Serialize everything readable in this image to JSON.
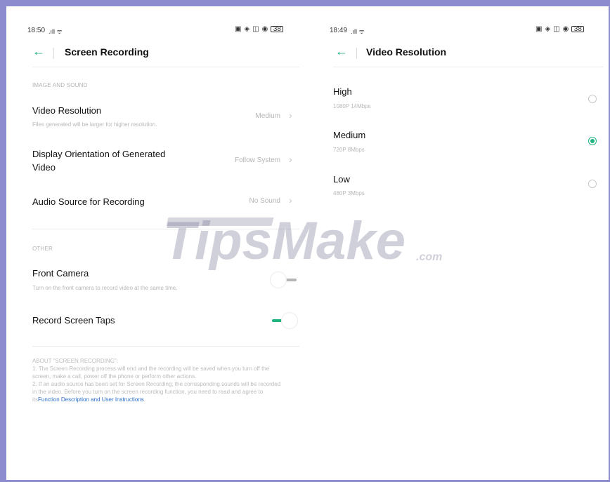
{
  "colors": {
    "accent": "#1fb37e",
    "frame": "#8d8ccf",
    "link": "#2b6fc8"
  },
  "left": {
    "status": {
      "time": "18:50",
      "battery": "38"
    },
    "header": {
      "back_icon": "arrow-left",
      "title": "Screen Recording"
    },
    "sections": {
      "image_sound": "IMAGE AND SOUND",
      "other": "OTHER"
    },
    "video_resolution": {
      "title": "Video Resolution",
      "subtitle": "Files generated will be larger for higher resolution.",
      "value": "Medium"
    },
    "display_orientation": {
      "title_line1": "Display Orientation of Generated",
      "title_line2": "Video",
      "value": "Follow System"
    },
    "audio_source": {
      "title": "Audio Source for Recording",
      "value": "No Sound"
    },
    "front_camera": {
      "title": "Front Camera",
      "subtitle": "Turn on the front camera to record video at the same time.",
      "enabled": false
    },
    "record_taps": {
      "title": "Record Screen Taps",
      "enabled": true
    },
    "about": {
      "heading": "ABOUT \"SCREEN RECORDING\":",
      "p1": "1. The Screen Recording process will end and the recording will be saved when you turn off the screen, make a call, power off the phone or perform other actions.",
      "p2_prefix": "2. If an audio source has been set for Screen Recording, the corresponding sounds will be recorded in the video. Before you turn on the screen recording function, you need to read and agree to its",
      "link": "Function Description and User Instructions",
      "p2_suffix": "."
    }
  },
  "right": {
    "status": {
      "time": "18:49",
      "battery": "38"
    },
    "header": {
      "back_icon": "arrow-left",
      "title": "Video Resolution"
    },
    "options": [
      {
        "label": "High",
        "detail": "1080P 14Mbps",
        "selected": false
      },
      {
        "label": "Medium",
        "detail": "720P 8Mbps",
        "selected": true
      },
      {
        "label": "Low",
        "detail": "480P 3Mbps",
        "selected": false
      }
    ]
  },
  "watermark": {
    "main": "TipsMake",
    "suffix": ".com"
  }
}
